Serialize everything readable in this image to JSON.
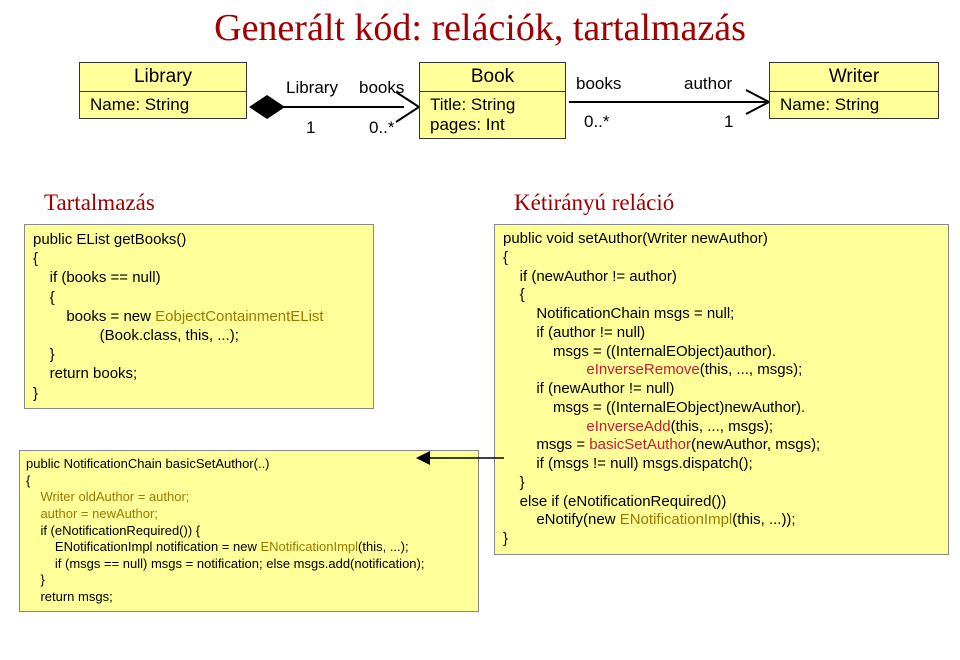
{
  "page_title": "Generált kód: relációk, tartalmazás",
  "uml": {
    "library": {
      "name": "Library",
      "attrs": "Name: String"
    },
    "book": {
      "name": "Book",
      "attrs": "Title: String\npages: Int"
    },
    "writer": {
      "name": "Writer",
      "attrs": "Name: String"
    },
    "assoc1": {
      "leftRole": "Library",
      "leftCard": "1",
      "rightRole": "books",
      "rightCard": "0..*"
    },
    "assoc2": {
      "leftRole": "books",
      "leftCard": "0..*",
      "rightRole": "author",
      "rightCard": "1"
    }
  },
  "left_title": "Tartalmazás",
  "right_title": "Kétirányú reláció",
  "code1": {
    "l1": "public EList getBooks()",
    "l2": "{",
    "l3": "    if (books == null)",
    "l4": "    {",
    "l5a": "        books = new ",
    "l5b": "EobjectContainmentEList",
    "l6": "                (Book.class, this, ...);",
    "l7": "    }",
    "l8": "    return books;",
    "l9": "}"
  },
  "code2": {
    "l1": "public NotificationChain basicSetAuthor(..)",
    "l2": "{",
    "l3": "    Writer oldAuthor = author;",
    "l4": "    author = newAuthor;",
    "l5": "    if (eNotificationRequired()) {",
    "l6a": "        ENotificationImpl notification = new ",
    "l6b": "ENotificationImpl",
    "l6c": "(this, ...);",
    "l7": "        if (msgs == null) msgs = notification; else msgs.add(notification);",
    "l8": "    }",
    "l9": "    return msgs;"
  },
  "code3": {
    "l1": "public void setAuthor(Writer newAuthor)",
    "l2": "{",
    "l3": "    if (newAuthor != author)",
    "l4": "    {",
    "l5": "        NotificationChain msgs = null;",
    "l6": "        if (author != null)",
    "l7": "            msgs = ((InternalEObject)author).",
    "l8a": "                    ",
    "l8b": "eInverseRemove",
    "l8c": "(this, ..., msgs);",
    "l9": "        if (newAuthor != null)",
    "l10": "            msgs = ((InternalEObject)newAuthor).",
    "l11a": "                    ",
    "l11b": "eInverseAdd",
    "l11c": "(this, ..., msgs);",
    "l12a": "        msgs = ",
    "l12b": "basicSetAuthor",
    "l12c": "(newAuthor, msgs);",
    "l13": "        if (msgs != null) msgs.dispatch();",
    "l14": "    }",
    "l15": "    else if (eNotificationRequired())",
    "l16a": "        eNotify(new ",
    "l16b": "ENotificationImpl",
    "l16c": "(this, ...));",
    "l17": "}"
  },
  "colors": {
    "title_red": "#a00000",
    "box_yellow": "#ffff99"
  }
}
